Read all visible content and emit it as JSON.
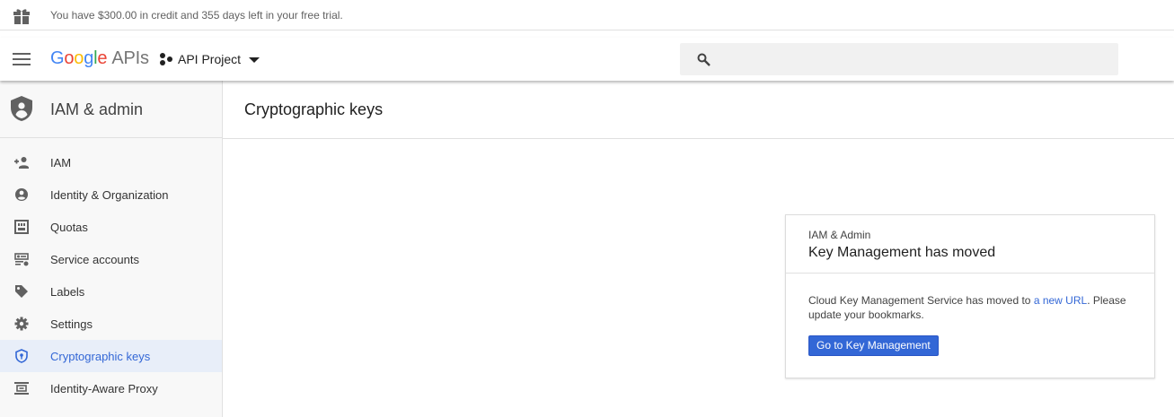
{
  "banner": {
    "text": "You have $300.00 in credit and 355 days left in your free trial."
  },
  "header": {
    "logo": {
      "g1": "G",
      "g2": "o",
      "g3": "o",
      "g4": "g",
      "g5": "l",
      "g6": "e",
      "apis": "APIs"
    },
    "project": "API Project",
    "search": {
      "placeholder": "",
      "value": ""
    }
  },
  "sidebar": {
    "title": "IAM & admin",
    "items": [
      {
        "label": "IAM",
        "icon": "add-person-icon"
      },
      {
        "label": "Identity & Organization",
        "icon": "account-circle-icon"
      },
      {
        "label": "Quotas",
        "icon": "quota-icon"
      },
      {
        "label": "Service accounts",
        "icon": "service-account-icon"
      },
      {
        "label": "Labels",
        "icon": "label-icon"
      },
      {
        "label": "Settings",
        "icon": "gear-icon"
      },
      {
        "label": "Cryptographic keys",
        "icon": "shield-key-icon",
        "active": true
      },
      {
        "label": "Identity-Aware Proxy",
        "icon": "proxy-icon"
      }
    ]
  },
  "main": {
    "title": "Cryptographic keys",
    "card": {
      "eyebrow": "IAM & Admin",
      "heading": "Key Management has moved",
      "body_before": "Cloud Key Management Service has moved to ",
      "link": "a new URL",
      "body_after": ". Please update your bookmarks.",
      "button": "Go to Key Management"
    }
  },
  "colors": {
    "accent": "#3367d6",
    "active_bg": "#e8eef9",
    "sidebar_bg": "#f8f8f8"
  }
}
